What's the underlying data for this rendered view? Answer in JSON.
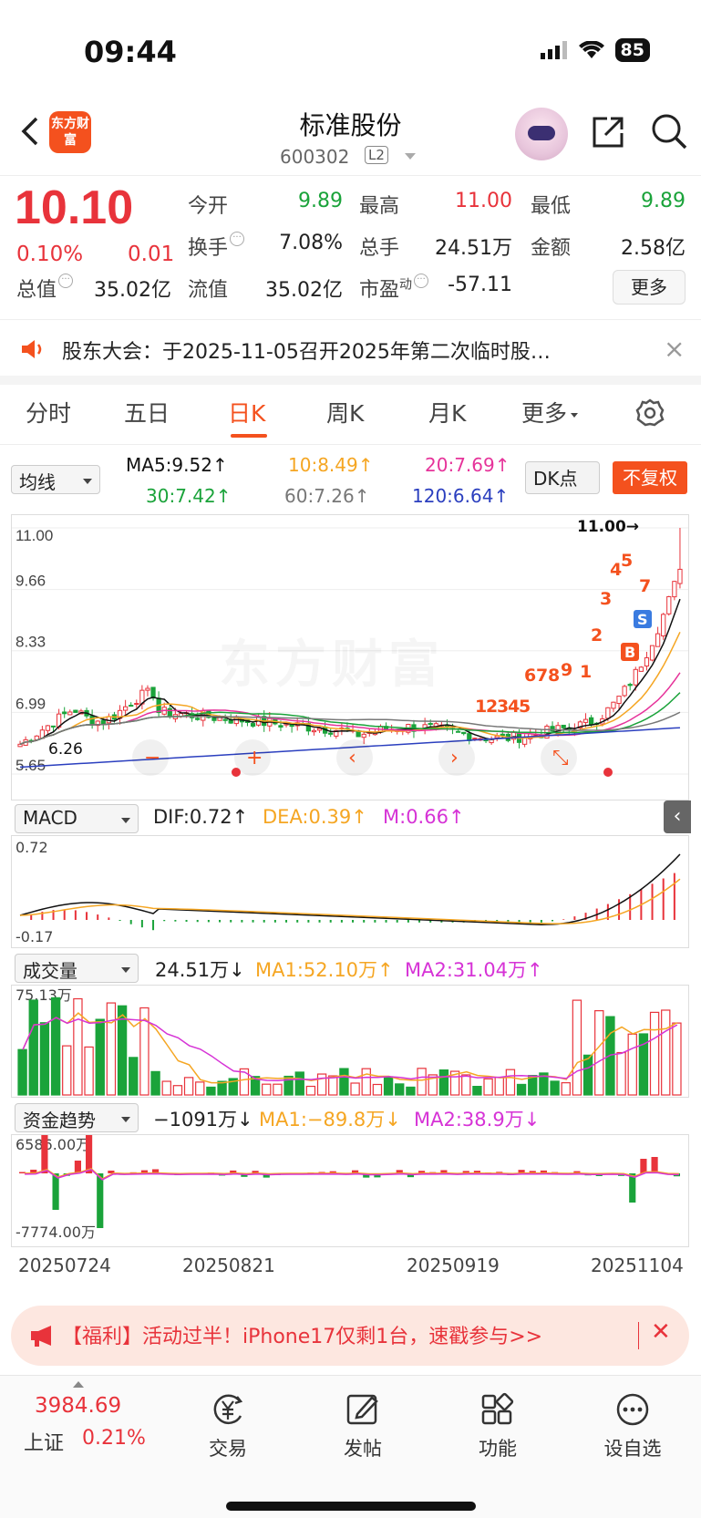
{
  "status": {
    "time": "09:44",
    "battery": "85"
  },
  "header": {
    "logo": "东方财富",
    "name": "标准股份",
    "code": "600302",
    "level": "L2"
  },
  "quote": {
    "price": "10.10",
    "pct": "0.10%",
    "change": "0.01",
    "open_label": "今开",
    "open": "9.89",
    "high_label": "最高",
    "high": "11.00",
    "low_label": "最低",
    "low": "9.89",
    "turnover_label": "换手",
    "turnover": "7.08%",
    "volume_label": "总手",
    "volume": "24.51万",
    "amount_label": "金额",
    "amount": "2.58亿",
    "mktcap_label": "总值",
    "mktcap": "35.02亿",
    "float_label": "流值",
    "float": "35.02亿",
    "pe_label": "市盈",
    "pe_sup": "动",
    "pe": "-57.11",
    "more": "更多"
  },
  "notice": {
    "text": "股东大会：于2025-11-05召开2025年第二次临时股…"
  },
  "tabs": [
    "分时",
    "五日",
    "日K",
    "周K",
    "月K",
    "更多"
  ],
  "ma": {
    "selector": "均线",
    "ma5": "MA5:9.52",
    "ma10": "10:8.49",
    "ma20": "20:7.69",
    "ma30": "30:7.42",
    "ma60": "60:7.26",
    "ma120": "120:6.64",
    "dk": "DK点",
    "fq": "不复权"
  },
  "kline": {
    "y_ticks": [
      "11.00",
      "9.66",
      "8.33",
      "6.99",
      "5.65"
    ],
    "max_mark": "11.00",
    "min_mark": "6.26",
    "signal_numbers": [
      "1",
      "2",
      "3",
      "4",
      "5",
      "6",
      "7",
      "8",
      "9",
      "1",
      "2",
      "3",
      "4",
      "5",
      "7"
    ],
    "buy": "B",
    "sell": "S",
    "watermark": "东方财富"
  },
  "macd": {
    "selector": "MACD",
    "dif": "DIF:0.72",
    "dea": "DEA:0.39",
    "m": "M:0.66",
    "top": "0.72",
    "bottom": "-0.17"
  },
  "vol": {
    "selector": "成交量",
    "value": "24.51万",
    "ma1": "MA1:52.10万",
    "ma2": "MA2:31.04万",
    "top": "75.13万"
  },
  "fund": {
    "selector": "资金趋势",
    "value": "−1091万",
    "ma1": "MA1:−89.8万",
    "ma2": "MA2:38.9万",
    "top": "6586.00万",
    "bottom": "-7774.00万"
  },
  "dates": [
    "20250724",
    "20250821",
    "20250919",
    "20251104"
  ],
  "banner": {
    "text": "【福利】活动过半！iPhone17仅剩1台，速戳参与>>"
  },
  "bottom": {
    "index_value": "3984.69",
    "index_name": "上证",
    "index_pct": "0.21%",
    "items": [
      "交易",
      "发帖",
      "功能",
      "设自选"
    ]
  },
  "colors": {
    "red": "#e8333b",
    "green": "#1aa33a",
    "orange": "#f4511e",
    "ma5": "#111111",
    "ma10": "#f5a623",
    "ma20": "#e6339a",
    "ma30": "#1aa33a",
    "ma60": "#777777",
    "ma120": "#2b3fbf"
  }
}
